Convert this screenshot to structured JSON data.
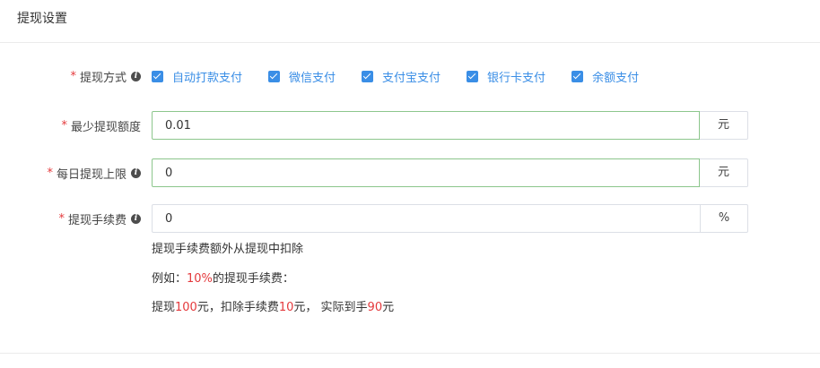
{
  "panel": {
    "title": "提现设置"
  },
  "withdraw_methods": {
    "label": "提现方式",
    "required_mark": "*",
    "options": [
      {
        "label": "自动打款支付",
        "checked": true
      },
      {
        "label": "微信支付",
        "checked": true
      },
      {
        "label": "支付宝支付",
        "checked": true
      },
      {
        "label": "银行卡支付",
        "checked": true
      },
      {
        "label": "余额支付",
        "checked": true
      }
    ]
  },
  "min_amount": {
    "label": "最少提现额度",
    "required_mark": "*",
    "value": "0.01",
    "unit": "元"
  },
  "daily_limit": {
    "label": "每日提现上限",
    "required_mark": "*",
    "value": "0",
    "unit": "元"
  },
  "fee": {
    "label": "提现手续费",
    "required_mark": "*",
    "value": "0",
    "unit": "%",
    "help_line1": "提现手续费额外从提现中扣除",
    "example_prefix": "例如：",
    "example_rate": "10%",
    "example_suffix": "的提现手续费：",
    "line3_a": "提现",
    "line3_amount": "100",
    "line3_b": "元，扣除手续费",
    "line3_fee": "10",
    "line3_c": "元， 实际到手",
    "line3_net": "90",
    "line3_d": "元"
  },
  "colors": {
    "accent": "#3a8ee6",
    "required": "#e4393c",
    "active_border": "#8cc68c"
  }
}
